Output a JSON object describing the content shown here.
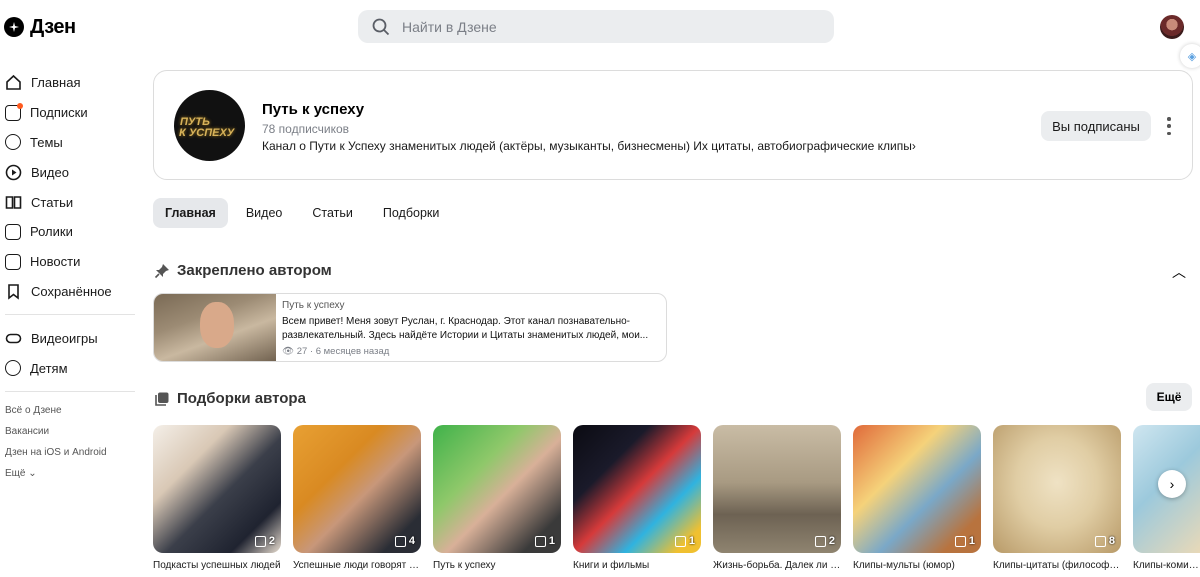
{
  "header": {
    "logo_text": "Дзен",
    "search_placeholder": "Найти в Дзене"
  },
  "sidebar": {
    "items": [
      {
        "label": "Главная",
        "icon": "home-icon"
      },
      {
        "label": "Подписки",
        "icon": "subscriptions-icon"
      },
      {
        "label": "Темы",
        "icon": "compass-icon"
      },
      {
        "label": "Видео",
        "icon": "play-icon"
      },
      {
        "label": "Статьи",
        "icon": "book-icon"
      },
      {
        "label": "Ролики",
        "icon": "shorts-icon"
      },
      {
        "label": "Новости",
        "icon": "news-icon"
      },
      {
        "label": "Сохранённое",
        "icon": "bookmark-icon"
      }
    ],
    "extra": [
      {
        "label": "Видеоигры",
        "icon": "gamepad-icon"
      },
      {
        "label": "Детям",
        "icon": "bear-icon"
      }
    ],
    "footer": [
      "Всё о Дзене",
      "Вакансии",
      "Дзен на iOS и Android",
      "Ещё"
    ]
  },
  "channel": {
    "name": "Путь к успеху",
    "subscribers": "78 подписчиков",
    "description": "Канал о Пути к Успеху знаменитых людей (актёры, музыканты, бизнесмены) Их цитаты, автобиографические клипы",
    "subscribe_label": "Вы подписаны",
    "avatar_line1": "ПУТЬ",
    "avatar_line2": "К УСПЕХУ"
  },
  "tabs": [
    "Главная",
    "Видео",
    "Статьи",
    "Подборки"
  ],
  "pinned": {
    "title": "Закреплено автором",
    "source": "Путь к успеху",
    "text": "Всем привет! Меня зовут Руслан, г. Краснодар. Этот канал познавательно-развлекательный. Здесь найдёте Истории и Цитаты знаменитых людей, мои...",
    "views": "27",
    "time": "· 6 месяцев назад"
  },
  "collections": {
    "title": "Подборки автора",
    "more_label": "Ещё",
    "items": [
      {
        "label": "Подкасты успешных людей",
        "count": "2"
      },
      {
        "label": "Успешные люди говорят о...",
        "count": "4"
      },
      {
        "label": "Путь к успеху",
        "count": "1"
      },
      {
        "label": "Книги и фильмы",
        "count": "1"
      },
      {
        "label": "Жизнь-борьба. Далек ли успех?",
        "count": "2"
      },
      {
        "label": "Клипы-мульты (юмор)",
        "count": "1"
      },
      {
        "label": "Клипы-цитаты (философы и мудрецы)",
        "count": "8"
      },
      {
        "label": "Клипы-комиксы, которой стоит...",
        "count": ""
      }
    ]
  }
}
